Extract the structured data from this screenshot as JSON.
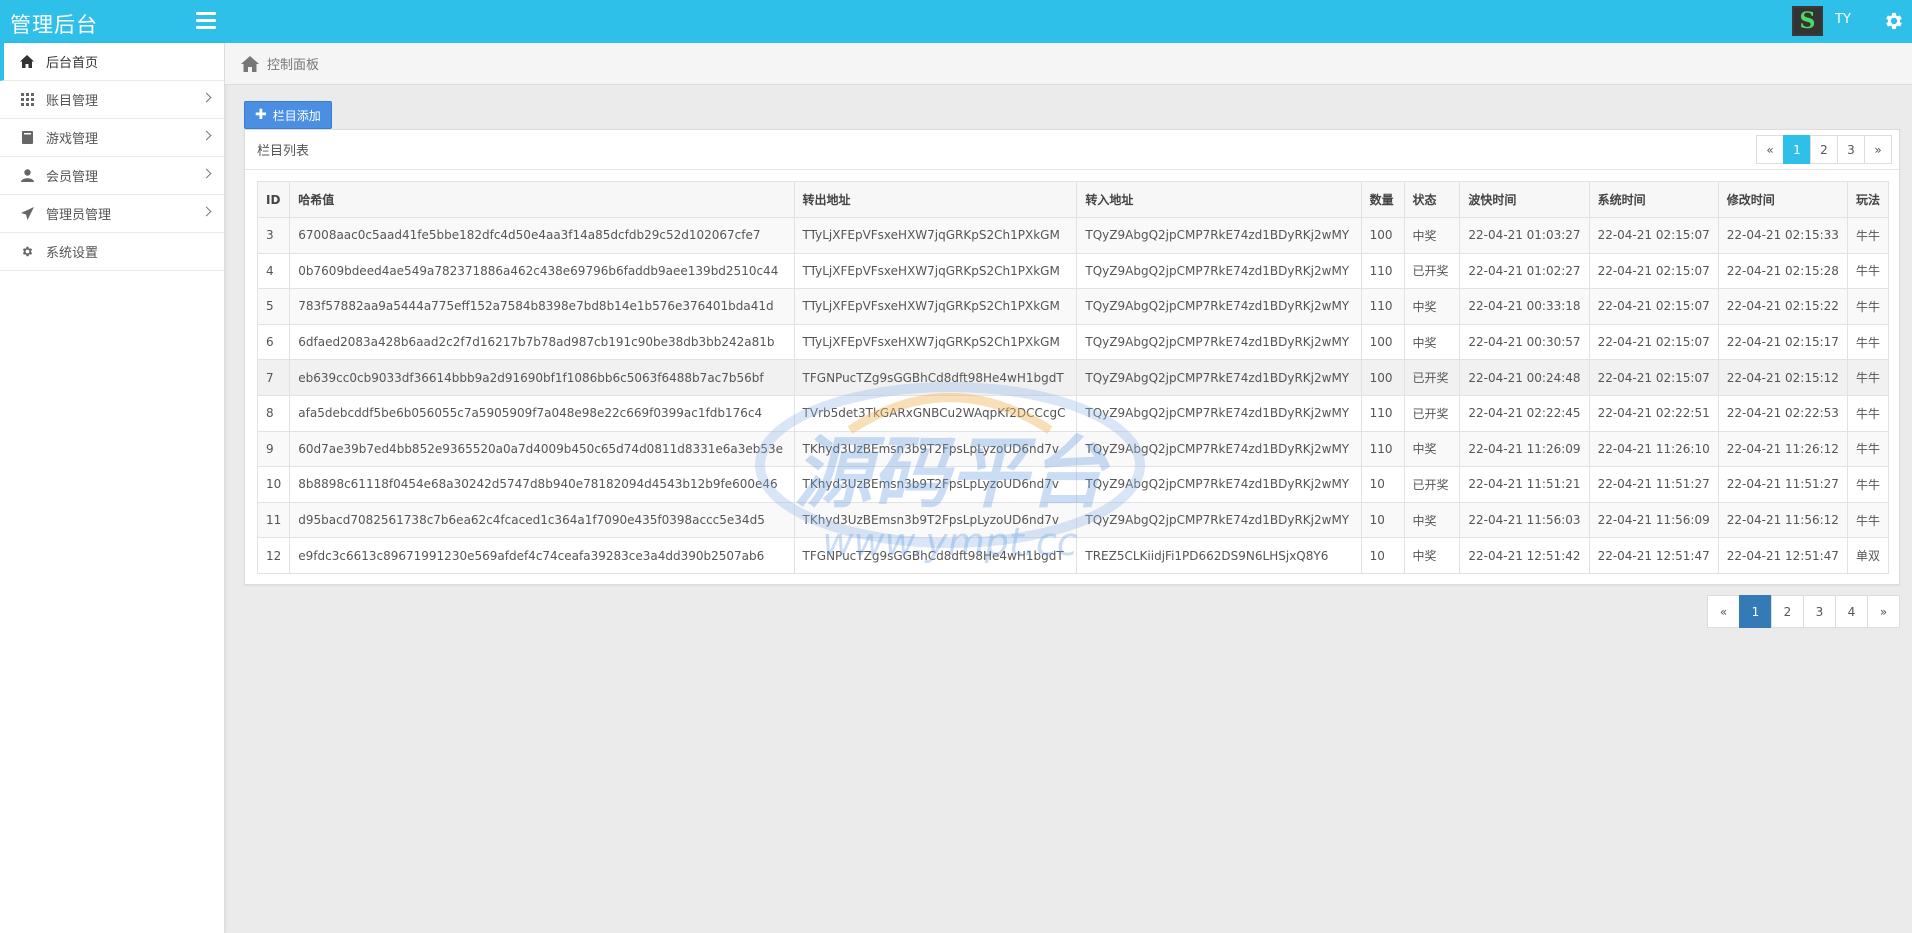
{
  "app": {
    "title": "管理后台"
  },
  "user": {
    "name": "TY",
    "avatar_letter": "S"
  },
  "sidebar": {
    "items": [
      {
        "label": "后台首页",
        "icon": "home-icon",
        "active": true
      },
      {
        "label": "账目管理",
        "icon": "grid-icon",
        "arrow": true
      },
      {
        "label": "游戏管理",
        "icon": "book-icon",
        "arrow": true
      },
      {
        "label": "会员管理",
        "icon": "user-icon",
        "arrow": true
      },
      {
        "label": "管理员管理",
        "icon": "send-icon",
        "arrow": true
      },
      {
        "label": "系统设置",
        "icon": "gear-icon"
      }
    ]
  },
  "breadcrumb": {
    "label": "控制面板"
  },
  "toolbar": {
    "add_label": "栏目添加"
  },
  "panel": {
    "title": "栏目列表"
  },
  "pager_top": {
    "prev": "«",
    "next": "»",
    "pages": [
      "1",
      "2",
      "3"
    ],
    "current": "1"
  },
  "pager_bottom": {
    "prev": "«",
    "next": "»",
    "pages": [
      "1",
      "2",
      "3",
      "4"
    ],
    "current": "1"
  },
  "table": {
    "headers": [
      "ID",
      "哈希值",
      "转出地址",
      "转入地址",
      "数量",
      "状态",
      "波快时间",
      "系统时间",
      "修改时间",
      "玩法"
    ],
    "rows": [
      [
        "3",
        "67008aac0c5aad41fe5bbe182dfc4d50e4aa3f14a85dcfdb29c52d102067cfe7",
        "TTyLjXFEpVFsxeHXW7jqGRKpS2Ch1PXkGM",
        "TQyZ9AbgQ2jpCMP7RkE74zd1BDyRKj2wMY",
        "100",
        "中奖",
        "22-04-21 01:03:27",
        "22-04-21 02:15:07",
        "22-04-21 02:15:33",
        "牛牛"
      ],
      [
        "4",
        "0b7609bdeed4ae549a782371886a462c438e69796b6faddb9aee139bd2510c44",
        "TTyLjXFEpVFsxeHXW7jqGRKpS2Ch1PXkGM",
        "TQyZ9AbgQ2jpCMP7RkE74zd1BDyRKj2wMY",
        "110",
        "已开奖",
        "22-04-21 01:02:27",
        "22-04-21 02:15:07",
        "22-04-21 02:15:28",
        "牛牛"
      ],
      [
        "5",
        "783f57882aa9a5444a775eff152a7584b8398e7bd8b14e1b576e376401bda41d",
        "TTyLjXFEpVFsxeHXW7jqGRKpS2Ch1PXkGM",
        "TQyZ9AbgQ2jpCMP7RkE74zd1BDyRKj2wMY",
        "110",
        "中奖",
        "22-04-21 00:33:18",
        "22-04-21 02:15:07",
        "22-04-21 02:15:22",
        "牛牛"
      ],
      [
        "6",
        "6dfaed2083a428b6aad2c2f7d16217b7b78ad987cb191c90be38db3bb242a81b",
        "TTyLjXFEpVFsxeHXW7jqGRKpS2Ch1PXkGM",
        "TQyZ9AbgQ2jpCMP7RkE74zd1BDyRKj2wMY",
        "100",
        "中奖",
        "22-04-21 00:30:57",
        "22-04-21 02:15:07",
        "22-04-21 02:15:17",
        "牛牛"
      ],
      [
        "7",
        "eb639cc0cb9033df36614bbb9a2d91690bf1f1086bb6c5063f6488b7ac7b56bf",
        "TFGNPucTZg9sGGBhCd8dft98He4wH1bgdT",
        "TQyZ9AbgQ2jpCMP7RkE74zd1BDyRKj2wMY",
        "100",
        "已开奖",
        "22-04-21 00:24:48",
        "22-04-21 02:15:07",
        "22-04-21 02:15:12",
        "牛牛"
      ],
      [
        "8",
        "afa5debcddf5be6b056055c7a5905909f7a048e98e22c669f0399ac1fdb176c4",
        "TVrb5det3TkGARxGNBCu2WAqpKf2DCCcgC",
        "TQyZ9AbgQ2jpCMP7RkE74zd1BDyRKj2wMY",
        "110",
        "已开奖",
        "22-04-21 02:22:45",
        "22-04-21 02:22:51",
        "22-04-21 02:22:53",
        "牛牛"
      ],
      [
        "9",
        "60d7ae39b7ed4bb852e9365520a0a7d4009b450c65d74d0811d8331e6a3eb53e",
        "TKhyd3UzBEmsn3b9T2FpsLpLyzoUD6nd7v",
        "TQyZ9AbgQ2jpCMP7RkE74zd1BDyRKj2wMY",
        "110",
        "中奖",
        "22-04-21 11:26:09",
        "22-04-21 11:26:10",
        "22-04-21 11:26:12",
        "牛牛"
      ],
      [
        "10",
        "8b8898c61118f0454e68a30242d5747d8b940e78182094d4543b12b9fe600e46",
        "TKhyd3UzBEmsn3b9T2FpsLpLyzoUD6nd7v",
        "TQyZ9AbgQ2jpCMP7RkE74zd1BDyRKj2wMY",
        "10",
        "已开奖",
        "22-04-21 11:51:21",
        "22-04-21 11:51:27",
        "22-04-21 11:51:27",
        "牛牛"
      ],
      [
        "11",
        "d95bacd7082561738c7b6ea62c4fcaced1c364a1f7090e435f0398accc5e34d5",
        "TKhyd3UzBEmsn3b9T2FpsLpLyzoUD6nd7v",
        "TQyZ9AbgQ2jpCMP7RkE74zd1BDyRKj2wMY",
        "10",
        "中奖",
        "22-04-21 11:56:03",
        "22-04-21 11:56:09",
        "22-04-21 11:56:12",
        "牛牛"
      ],
      [
        "12",
        "e9fdc3c6613c89671991230e569afdef4c74ceafa39283ce3a4dd390b2507ab6",
        "TFGNPucTZg9sGGBhCd8dft98He4wH1bgdT",
        "TREZ5CLKiidjFi1PD662DS9N6LHSjxQ8Y6",
        "10",
        "中奖",
        "22-04-21 12:51:42",
        "22-04-21 12:51:47",
        "22-04-21 12:51:47",
        "单双"
      ]
    ]
  },
  "watermark": {
    "title": "源码平台",
    "url": "www.ympt.cc"
  },
  "colors": {
    "topbar": "#2ec0e8",
    "accent_button": "#4a8fe2",
    "pager_active_bottom": "#337ab7"
  }
}
